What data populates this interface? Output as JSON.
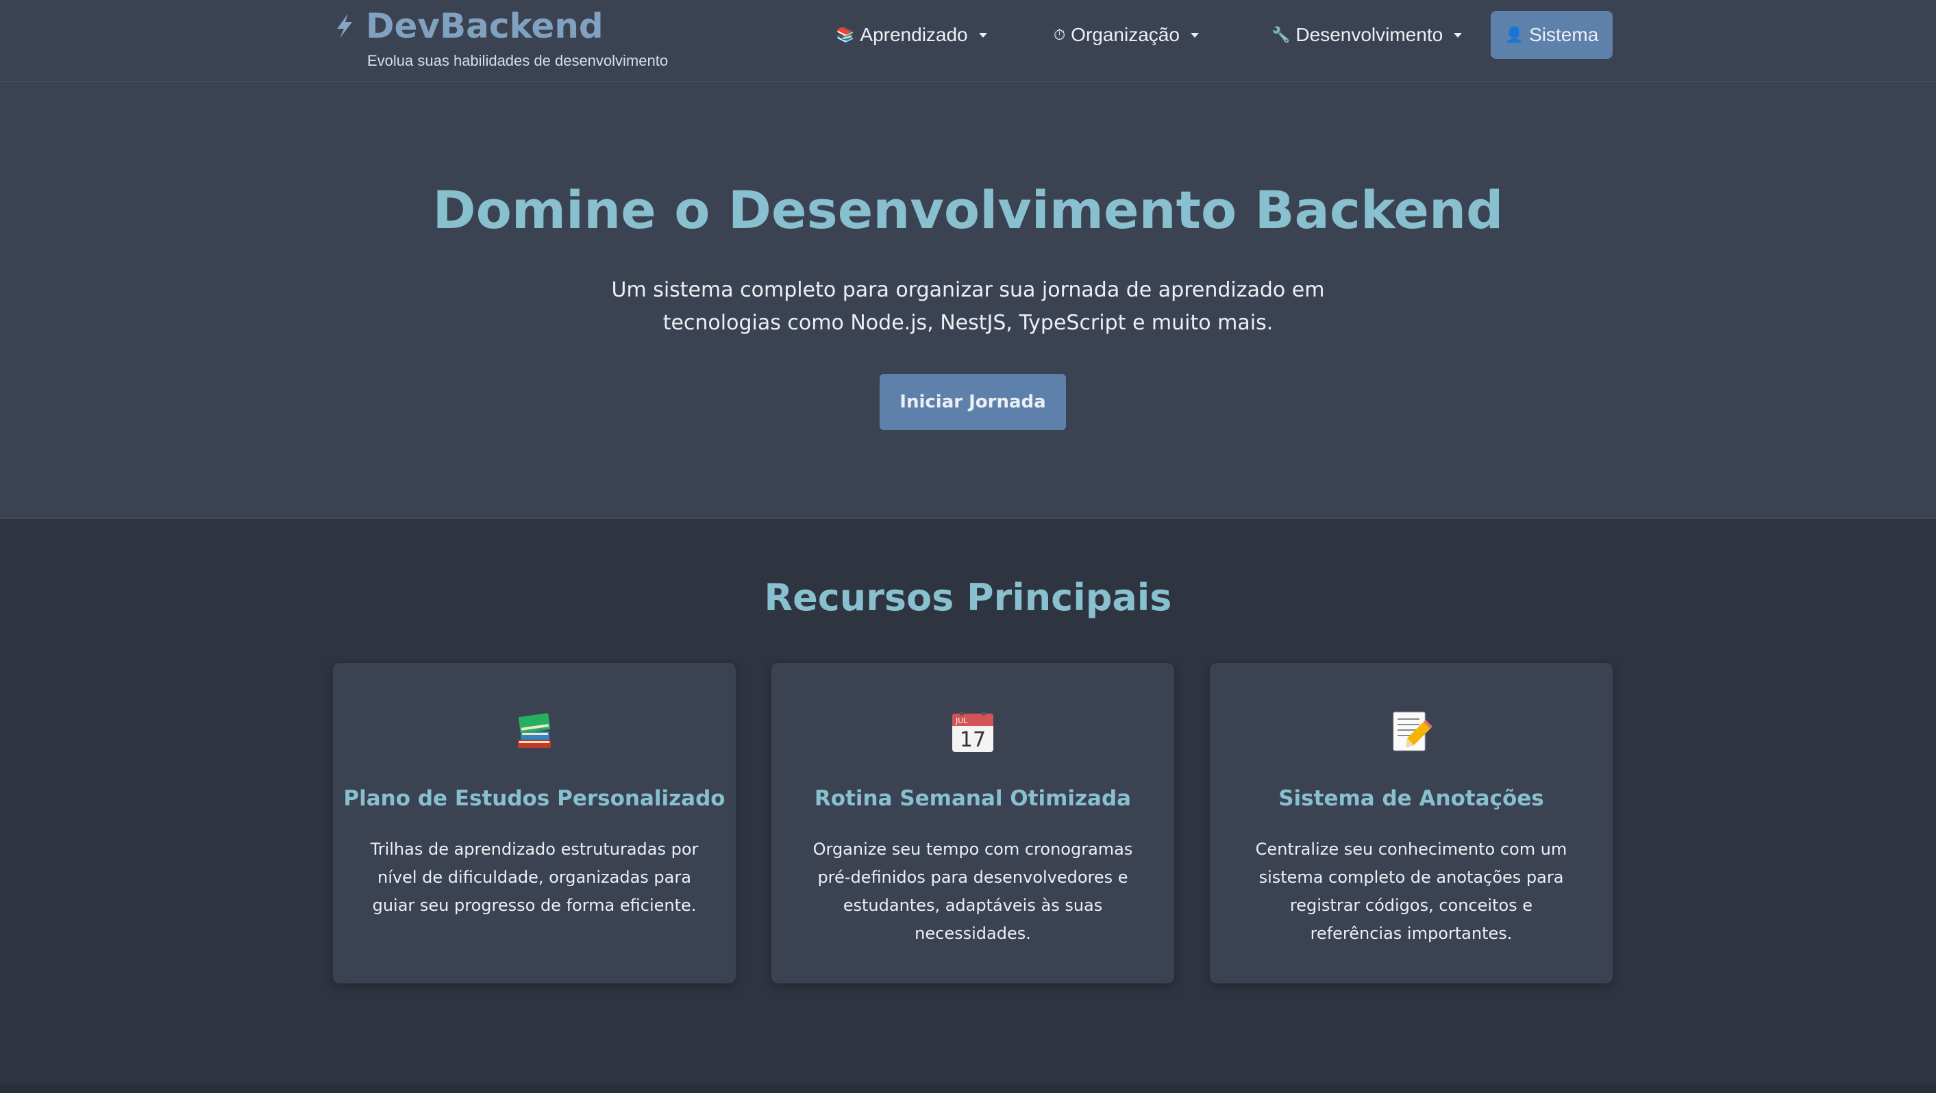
{
  "header": {
    "brand_title": "DevBackend",
    "brand_subtitle": "Evolua suas habilidades de desenvolvimento",
    "brand_icon": "lightning-icon",
    "nav": [
      {
        "label": "Aprendizado",
        "emoji": "📚",
        "icon": "books-icon",
        "dropdown": true
      },
      {
        "label": "Organização",
        "emoji": "⏱",
        "icon": "stopwatch-icon",
        "dropdown": true
      },
      {
        "label": "Desenvolvimento",
        "emoji": "🔧",
        "icon": "wrench-icon",
        "dropdown": true
      },
      {
        "label": "Sistema",
        "emoji": "👤",
        "icon": "user-icon",
        "dropdown": false
      }
    ]
  },
  "hero": {
    "title": "Domine o Desenvolvimento Backend",
    "description": "Um sistema completo para organizar sua jornada de aprendizado em tecnologias como Node.js, NestJS, TypeScript e muito mais.",
    "button_label": "Iniciar Jornada"
  },
  "features": {
    "title": "Recursos Principais",
    "cards": [
      {
        "icon": "books-icon",
        "title": "Plano de Estudos Personalizado",
        "text": "Trilhas de aprendizado estruturadas por nível de dificuldade, organizadas para guiar seu progresso de forma eficiente."
      },
      {
        "icon": "calendar-icon",
        "calendar_month": "JUL",
        "calendar_day": "17",
        "title": "Rotina Semanal Otimizada",
        "text": "Organize seu tempo com cronogramas pré-definidos para desenvolvedores e estudantes, adaptáveis às suas necessidades."
      },
      {
        "icon": "memo-icon",
        "title": "Sistema de Anotações",
        "text": "Centralize seu conhecimento com um sistema completo de anotações para registrar códigos, conceitos e referências importantes."
      }
    ]
  },
  "colors": {
    "background_dark": "#2e3440",
    "background_panel": "#3b4252",
    "accent_blue": "#5e81ac",
    "accent_cyan": "#88c0d0",
    "text_light": "#eceff4"
  }
}
